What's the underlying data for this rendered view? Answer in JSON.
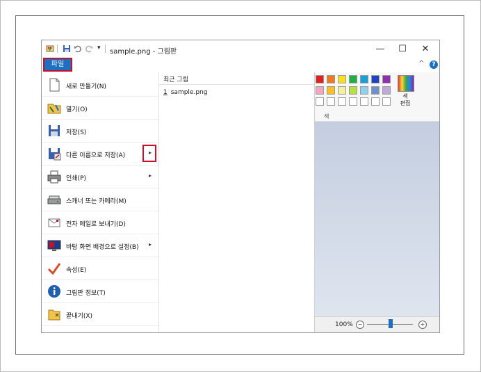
{
  "window": {
    "title": "sample.png - 그림판",
    "minimize_glyph": "—",
    "maximize_glyph": "☐",
    "close_glyph": "✕"
  },
  "quick_access": {
    "app_icon": "paint-app-icon",
    "save_icon": "save-icon",
    "undo_icon": "undo-icon",
    "redo_icon": "redo-icon",
    "customize_glyph": "▾"
  },
  "ribbon": {
    "file_tab": "파일",
    "collapse_glyph": "^",
    "help_glyph": "?",
    "colors_group_label": "색",
    "edit_colors_label": "색\n편집"
  },
  "file_menu": {
    "items": [
      {
        "label": "새로 만들기(N)",
        "icon": "new-document-icon",
        "submenu": false
      },
      {
        "label": "열기(O)",
        "icon": "open-folder-icon",
        "submenu": false
      },
      {
        "label": "저장(S)",
        "icon": "save-disk-icon",
        "submenu": false
      },
      {
        "label": "다른 이름으로 저장(A)",
        "icon": "save-as-icon",
        "submenu": true
      },
      {
        "label": "인쇄(P)",
        "icon": "printer-icon",
        "submenu": true
      },
      {
        "label": "스캐너 또는 카메라(M)",
        "icon": "scanner-icon",
        "submenu": false
      },
      {
        "label": "전자 메일로 보내기(D)",
        "icon": "email-icon",
        "submenu": false
      },
      {
        "label": "바탕 화면 배경으로 설정(B)",
        "icon": "desktop-background-icon",
        "submenu": true
      },
      {
        "label": "속성(E)",
        "icon": "checkmark-icon",
        "submenu": false
      },
      {
        "label": "그림판 정보(T)",
        "icon": "info-icon",
        "submenu": false
      },
      {
        "label": "끝내기(X)",
        "icon": "exit-icon",
        "submenu": false
      }
    ],
    "submenu_glyph": "▸",
    "recent": {
      "heading": "최근 그림",
      "items": [
        {
          "num": "1",
          "name": "sample.png"
        }
      ]
    }
  },
  "palette": {
    "row1": [
      "#e02020",
      "#f07820",
      "#f8e020",
      "#20b040",
      "#18a0d8",
      "#2040c8",
      "#9030b0"
    ],
    "row2": [
      "#f4a8c0",
      "#f8c020",
      "#f4f0a0",
      "#b8e040",
      "#90d0e8",
      "#7090c8",
      "#c0a8d8"
    ],
    "row3": [
      "#ffffff",
      "#ffffff",
      "#ffffff",
      "#ffffff",
      "#ffffff",
      "#ffffff",
      "#ffffff"
    ]
  },
  "statusbar": {
    "zoom": "100%",
    "zoom_out_glyph": "−",
    "zoom_in_glyph": "+"
  },
  "colors": {
    "accent_blue": "#1e6fbf",
    "highlight_red": "#c8102e"
  }
}
